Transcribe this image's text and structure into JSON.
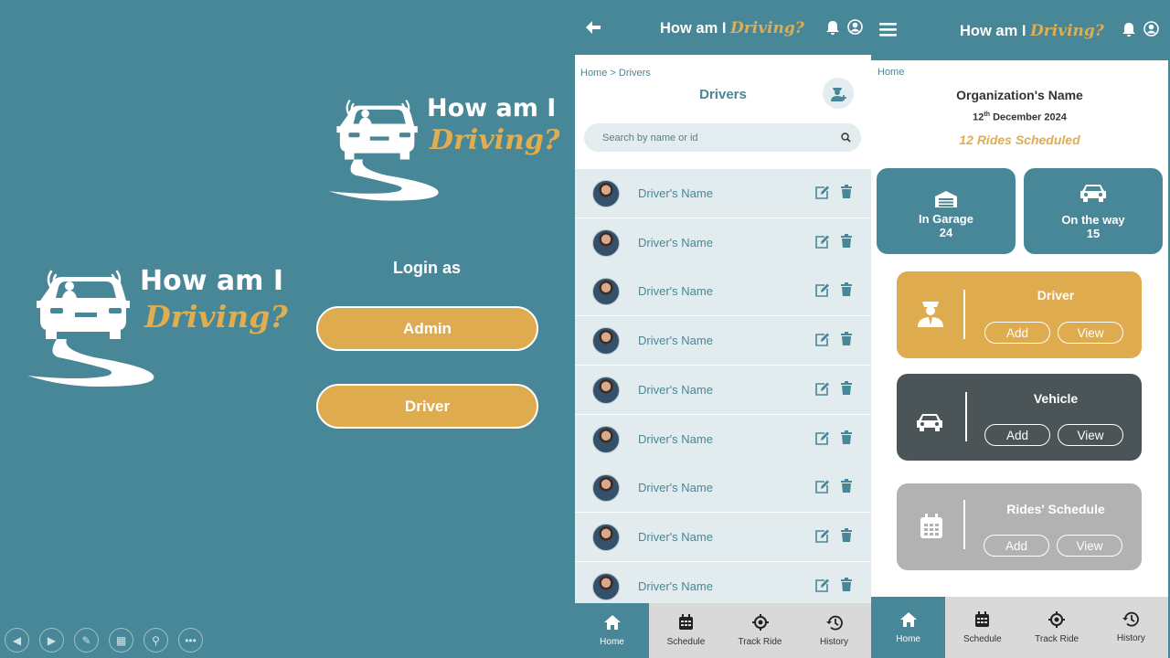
{
  "app": {
    "title_main": "How am I",
    "title_script": "Driving?"
  },
  "login": {
    "heading": "Login as",
    "admin_label": "Admin",
    "driver_label": "Driver"
  },
  "presenter_toolbar": [
    "prev-icon",
    "next-icon",
    "pen-icon",
    "slides-icon",
    "zoom-icon",
    "more-icon"
  ],
  "drivers_screen": {
    "breadcrumb_home": "Home",
    "breadcrumb_sep": ">",
    "breadcrumb_current": "Drivers",
    "page_title": "Drivers",
    "search_placeholder": "Search by name or id",
    "drivers": [
      {
        "name": "Driver's Name"
      },
      {
        "name": "Driver's Name"
      },
      {
        "name": "Driver's Name"
      },
      {
        "name": "Driver's Name"
      },
      {
        "name": "Driver's Name"
      },
      {
        "name": "Driver's Name"
      },
      {
        "name": "Driver's Name"
      },
      {
        "name": "Driver's Name"
      },
      {
        "name": "Driver's Name"
      }
    ],
    "nav": [
      {
        "label": "Home",
        "icon": "home-icon",
        "active": true
      },
      {
        "label": "Schedule",
        "icon": "calendar-icon",
        "active": false
      },
      {
        "label": "Track Ride",
        "icon": "target-icon",
        "active": false
      },
      {
        "label": "History",
        "icon": "history-icon",
        "active": false
      }
    ]
  },
  "home_screen": {
    "breadcrumb": "Home",
    "org_name": "Organization's Name",
    "date_day": "12",
    "date_suffix": "th",
    "date_rest": " December 2024",
    "rides_scheduled": "12 Rides Scheduled",
    "stats": {
      "garage_label": "In Garage",
      "garage_count": "24",
      "on_way_label": "On the way",
      "on_way_count": "15"
    },
    "cards": {
      "driver_title": "Driver",
      "vehicle_title": "Vehicle",
      "schedule_title": "Rides' Schedule",
      "add_label": "Add",
      "view_label": "View"
    },
    "colors": {
      "teal": "#488797",
      "gold": "#deab4f",
      "dark": "#4b5557",
      "grey": "#b2b2b2"
    },
    "nav": [
      {
        "label": "Home",
        "icon": "home-icon",
        "active": true
      },
      {
        "label": "Schedule",
        "icon": "calendar-icon",
        "active": false
      },
      {
        "label": "Track Ride",
        "icon": "target-icon",
        "active": false
      },
      {
        "label": "History",
        "icon": "history-icon",
        "active": false
      }
    ]
  }
}
